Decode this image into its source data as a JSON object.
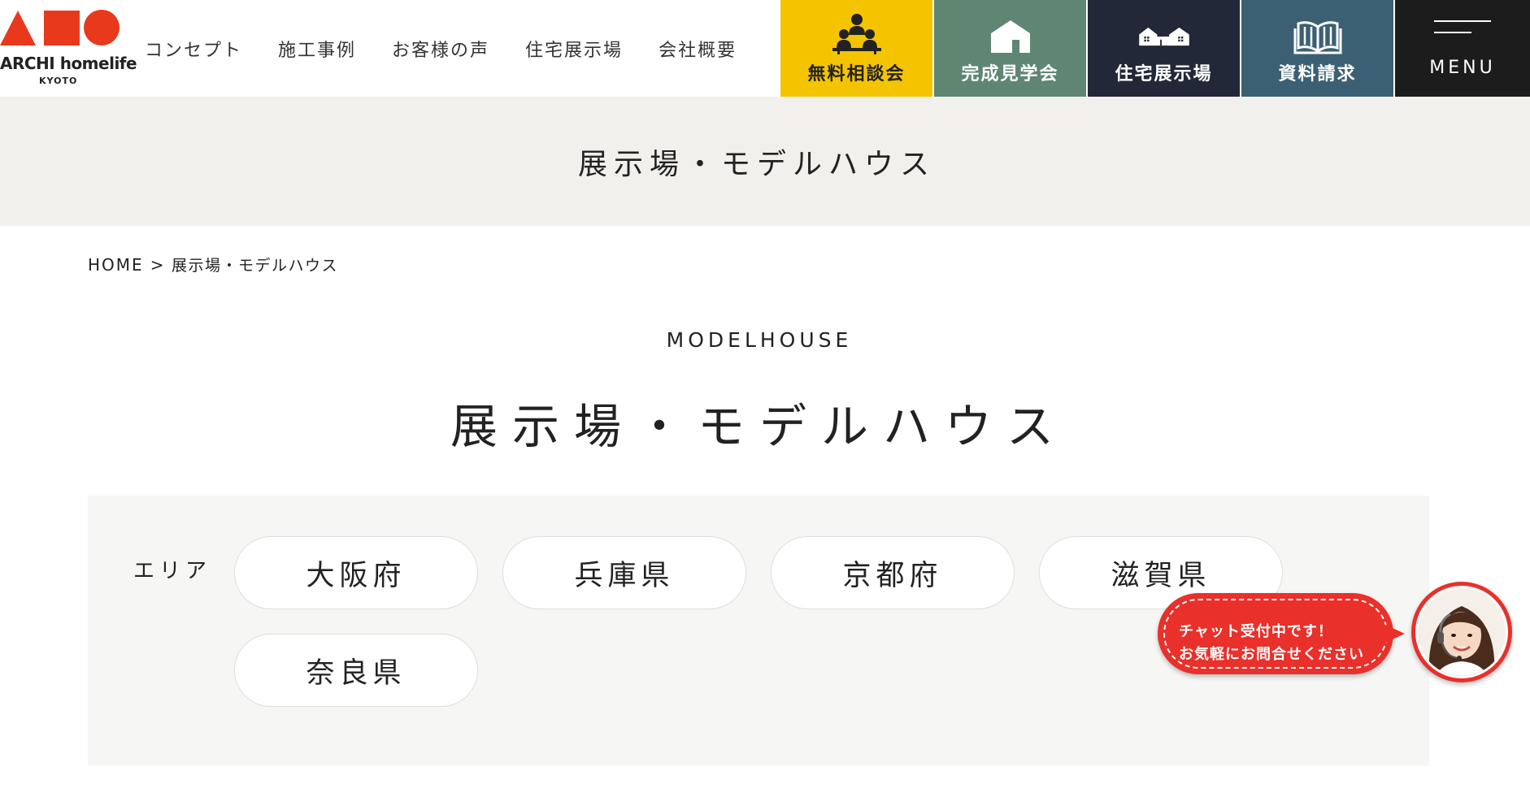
{
  "logo": {
    "text": "ARCHI homelife",
    "sub": "KYOTO",
    "colors": {
      "primary": "#e8391d"
    }
  },
  "nav": {
    "items": [
      {
        "label": "コンセプト"
      },
      {
        "label": "施工事例"
      },
      {
        "label": "お客様の声"
      },
      {
        "label": "住宅展示場"
      },
      {
        "label": "会社概要"
      }
    ]
  },
  "cta": {
    "consult": {
      "label": "無料相談会",
      "icon": "meeting-icon",
      "color": "#f5c400"
    },
    "tour": {
      "label": "完成見学会",
      "icon": "house-icon",
      "color": "#5f8672"
    },
    "showroom": {
      "label": "住宅展示場",
      "icon": "houses-icon",
      "color": "#232838"
    },
    "request": {
      "label": "資料請求",
      "icon": "book-icon",
      "color": "#3c6073"
    },
    "menu": {
      "label": "MENU",
      "icon": "hamburger-icon",
      "color": "#1c1c1c"
    }
  },
  "page": {
    "title": "展示場・モデルハウス"
  },
  "breadcrumb": {
    "home": "HOME",
    "separator": ">",
    "current": "展示場・モデルハウス"
  },
  "section": {
    "en": "MODELHOUSE",
    "ja": "展示場・モデルハウス"
  },
  "area": {
    "label": "エリア",
    "options": [
      {
        "label": "大阪府"
      },
      {
        "label": "兵庫県"
      },
      {
        "label": "京都府"
      },
      {
        "label": "滋賀県"
      },
      {
        "label": "奈良県"
      }
    ]
  },
  "chat": {
    "line1": "チャット受付中です！",
    "line2": "お気軽にお問合せください",
    "color": "#e9302a"
  }
}
